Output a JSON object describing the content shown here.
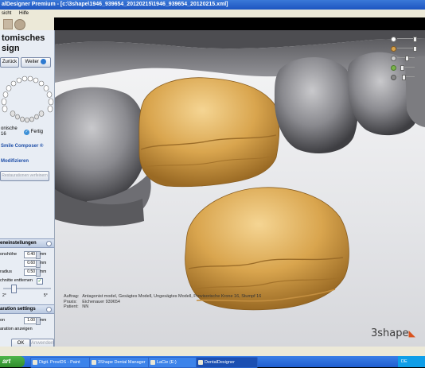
{
  "window": {
    "title": "alDesigner Premium - [c:\\3shape\\1946_939654_20120215\\1946_939654_20120215.xml]"
  },
  "menu": [
    "sicht",
    "Hilfe"
  ],
  "panel": {
    "title_line1": "tomisches",
    "title_line2": "sign",
    "back_label": "Zurück",
    "next_label": "Weiter",
    "tooth_label_line1": "onische",
    "tooth_label_line2": "16",
    "done_label": "Fertig",
    "composer_link": "Smile Composer ®",
    "modify_link": "Modifizieren",
    "reset_button": "Restaurationen verfeinern",
    "section_tool": "eneinstellungen",
    "section_prep": "aration settings",
    "settings": [
      {
        "label": "onshöhe",
        "value": "0.40",
        "unit": "mm"
      },
      {
        "label": "",
        "value": "0.60",
        "unit": "mm"
      },
      {
        "label": "radius",
        "value": "0.50",
        "unit": "mm"
      }
    ],
    "remove_label": "chnitte entfernen",
    "slider_min": "2°",
    "slider_max": "5°",
    "prep_label": "on",
    "prep_value": "1.00",
    "prep_unit": "mm",
    "show_prep_label": "aration anzeigen",
    "ok_label": "OK",
    "apply_label": "Anwenden"
  },
  "viewport": {
    "info": {
      "auftrag_key": "Auftrag:",
      "auftrag_val": "Antagonist model, Gesägtes Modell, Ungesägtes Modell, Provisorische Krone 16, Stumpf 16",
      "praxis_key": "Praxis:",
      "praxis_val": "Eichenauer 939654",
      "patient_key": "Patient:",
      "patient_val": "NN"
    },
    "logo": "3shape"
  },
  "taskbar": {
    "start": "art",
    "tasks": [
      "Digit. ProviDS - Paint",
      "3Shape Dental Manager",
      "LaCie (E:)",
      "DentalDesigner"
    ],
    "tray": "DE"
  },
  "colors": {
    "crown": "#d9a54e",
    "gum": "#7c7c80"
  }
}
